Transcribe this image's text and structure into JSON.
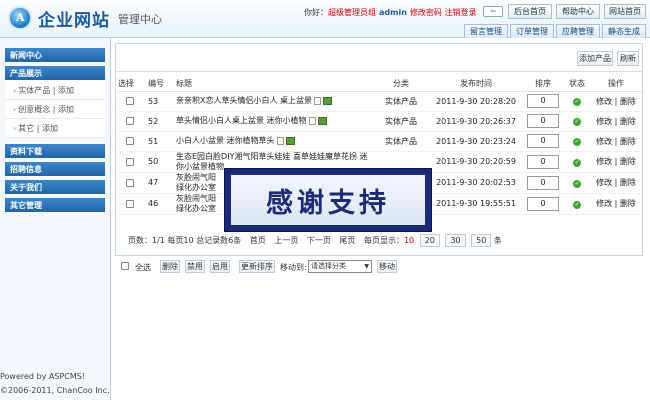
{
  "header": {
    "brand": "企业网站",
    "sub_brand": "管理中心",
    "greeting_prefix": "你好：",
    "role": "超级管理员组",
    "user": "admin",
    "change_password": "修改密码",
    "logout": "注销登录",
    "toggle_icon": "⇦",
    "buttons": [
      "后台首页",
      "帮助中心",
      "网站首页"
    ],
    "tabs": [
      "留言管理",
      "订单管理",
      "应聘管理",
      "静态生成"
    ]
  },
  "sidebar": {
    "sections": [
      {
        "label": "新闻中心"
      },
      {
        "label": "产品展示"
      },
      {
        "label": "资料下载"
      },
      {
        "label": "招聘信息"
      },
      {
        "label": "关于我们"
      },
      {
        "label": "其它管理"
      }
    ],
    "product_items": [
      "实体产品 | 添加",
      "创意概念 | 添加",
      "其它 | 添加"
    ],
    "footer_line1": "Powered by ASPCMS!",
    "footer_line2": "©2006-2011, ChanCoo Inc."
  },
  "toolbar": {
    "add_product": "添加产品",
    "refresh": "刷新"
  },
  "table": {
    "headers": {
      "select": "选择",
      "id": "编号",
      "title": "标题",
      "category": "分类",
      "time": "发布时间",
      "order": "排序",
      "status": "状态",
      "ops": "操作"
    },
    "rows": [
      {
        "id": "53",
        "title": "亲亲积X恋人草头情侣小白人 桌上盆景",
        "category": "实体产品",
        "time": "2011-9-30 20:28:20",
        "order": "0",
        "ops": "修改 | 删除"
      },
      {
        "id": "52",
        "title": "草头情侣小白人桌上盆景 迷你小植物",
        "category": "实体产品",
        "time": "2011-9-30 20:26:37",
        "order": "0",
        "ops": "修改 | 删除"
      },
      {
        "id": "51",
        "title": "小白人小盆景 迷你植物草头",
        "category": "实体产品",
        "time": "2011-9-30 20:23:24",
        "order": "0",
        "ops": "修改 | 删除"
      },
      {
        "id": "50",
        "title": "生态E园白脸DIY湘气阳草头娃娃 喜草娃娃魔草花拐 迷你小盆景植物",
        "category": "",
        "time": "2011-9-30 20:20:59",
        "order": "0",
        "ops": "修改 | 删除"
      },
      {
        "id": "47",
        "title": "灰脸闹气阳",
        "title2": "绿化办公室",
        "category": "",
        "time": "2011-9-30 20:02:53",
        "order": "0",
        "ops": "修改 | 删除"
      },
      {
        "id": "46",
        "title": "灰脸闹气阳",
        "title2": "绿化办公室",
        "category": "",
        "time": "2011-9-30 19:55:51",
        "order": "0",
        "ops": "修改 | 删除"
      }
    ]
  },
  "pager": {
    "summary": "页数：1/1 每页10 总记录数6条",
    "first": "首页",
    "prev": "上一页",
    "next": "下一页",
    "last": "尾页",
    "per_page_label": "每页显示：",
    "current": "10",
    "options": [
      "20",
      "30",
      "50"
    ],
    "unit": "条"
  },
  "bottom": {
    "select_all": "全选",
    "delete": "删除",
    "disable": "禁用",
    "enable": "启用",
    "update_order": "更新排序",
    "move_to": "移动到:",
    "select_category": "请选择分类",
    "move": "移动"
  },
  "overlay": {
    "text": "感谢支持"
  },
  "colors": {
    "accent": "#1f65a8",
    "danger": "#cc0000",
    "ok": "#3fa532",
    "overlay": "#1d2b76"
  }
}
